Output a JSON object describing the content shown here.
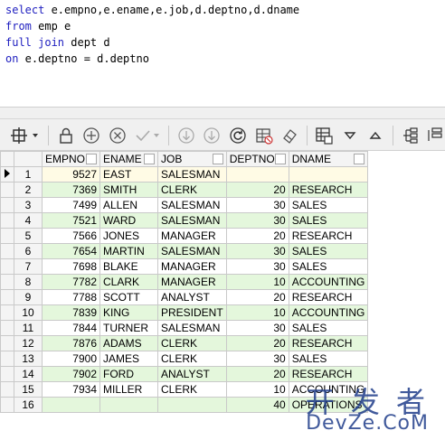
{
  "editor": {
    "line1": {
      "kw": "select",
      "rest": " e.empno,e.ename,e.job,d.deptno,d.dname"
    },
    "line2": {
      "kw": "from",
      "rest": " emp e"
    },
    "line3": {
      "kw": "full join",
      "rest": " dept d"
    },
    "line4": {
      "kw": "on",
      "rest": " e.deptno = d.deptno"
    }
  },
  "toolbar": {
    "icons": [
      "grid-options-icon",
      "lock-icon",
      "add-row-icon",
      "delete-row-icon",
      "post-icon",
      "first-icon",
      "last-icon",
      "refresh-icon",
      "clear-icon",
      "eraser-icon",
      "export-icon",
      "sort-desc-icon",
      "sort-asc-icon",
      "tree-icon",
      "more-icon"
    ]
  },
  "grid": {
    "columns": [
      "EMPNO",
      "ENAME",
      "JOB",
      "DEPTNO",
      "DNAME"
    ],
    "rows": [
      {
        "n": "1",
        "empno": "9527",
        "ename": "EAST",
        "job": "SALESMAN",
        "deptno": "",
        "dname": ""
      },
      {
        "n": "2",
        "empno": "7369",
        "ename": "SMITH",
        "job": "CLERK",
        "deptno": "20",
        "dname": "RESEARCH"
      },
      {
        "n": "3",
        "empno": "7499",
        "ename": "ALLEN",
        "job": "SALESMAN",
        "deptno": "30",
        "dname": "SALES"
      },
      {
        "n": "4",
        "empno": "7521",
        "ename": "WARD",
        "job": "SALESMAN",
        "deptno": "30",
        "dname": "SALES"
      },
      {
        "n": "5",
        "empno": "7566",
        "ename": "JONES",
        "job": "MANAGER",
        "deptno": "20",
        "dname": "RESEARCH"
      },
      {
        "n": "6",
        "empno": "7654",
        "ename": "MARTIN",
        "job": "SALESMAN",
        "deptno": "30",
        "dname": "SALES"
      },
      {
        "n": "7",
        "empno": "7698",
        "ename": "BLAKE",
        "job": "MANAGER",
        "deptno": "30",
        "dname": "SALES"
      },
      {
        "n": "8",
        "empno": "7782",
        "ename": "CLARK",
        "job": "MANAGER",
        "deptno": "10",
        "dname": "ACCOUNTING"
      },
      {
        "n": "9",
        "empno": "7788",
        "ename": "SCOTT",
        "job": "ANALYST",
        "deptno": "20",
        "dname": "RESEARCH"
      },
      {
        "n": "10",
        "empno": "7839",
        "ename": "KING",
        "job": "PRESIDENT",
        "deptno": "10",
        "dname": "ACCOUNTING"
      },
      {
        "n": "11",
        "empno": "7844",
        "ename": "TURNER",
        "job": "SALESMAN",
        "deptno": "30",
        "dname": "SALES"
      },
      {
        "n": "12",
        "empno": "7876",
        "ename": "ADAMS",
        "job": "CLERK",
        "deptno": "20",
        "dname": "RESEARCH"
      },
      {
        "n": "13",
        "empno": "7900",
        "ename": "JAMES",
        "job": "CLERK",
        "deptno": "30",
        "dname": "SALES"
      },
      {
        "n": "14",
        "empno": "7902",
        "ename": "FORD",
        "job": "ANALYST",
        "deptno": "20",
        "dname": "RESEARCH"
      },
      {
        "n": "15",
        "empno": "7934",
        "ename": "MILLER",
        "job": "CLERK",
        "deptno": "10",
        "dname": "ACCOUNTING"
      },
      {
        "n": "16",
        "empno": "",
        "ename": "",
        "job": "",
        "deptno": "40",
        "dname": "OPERATIONS"
      }
    ]
  },
  "watermark": {
    "top": "开 发 者",
    "bottom": "DevZe.CoM"
  }
}
